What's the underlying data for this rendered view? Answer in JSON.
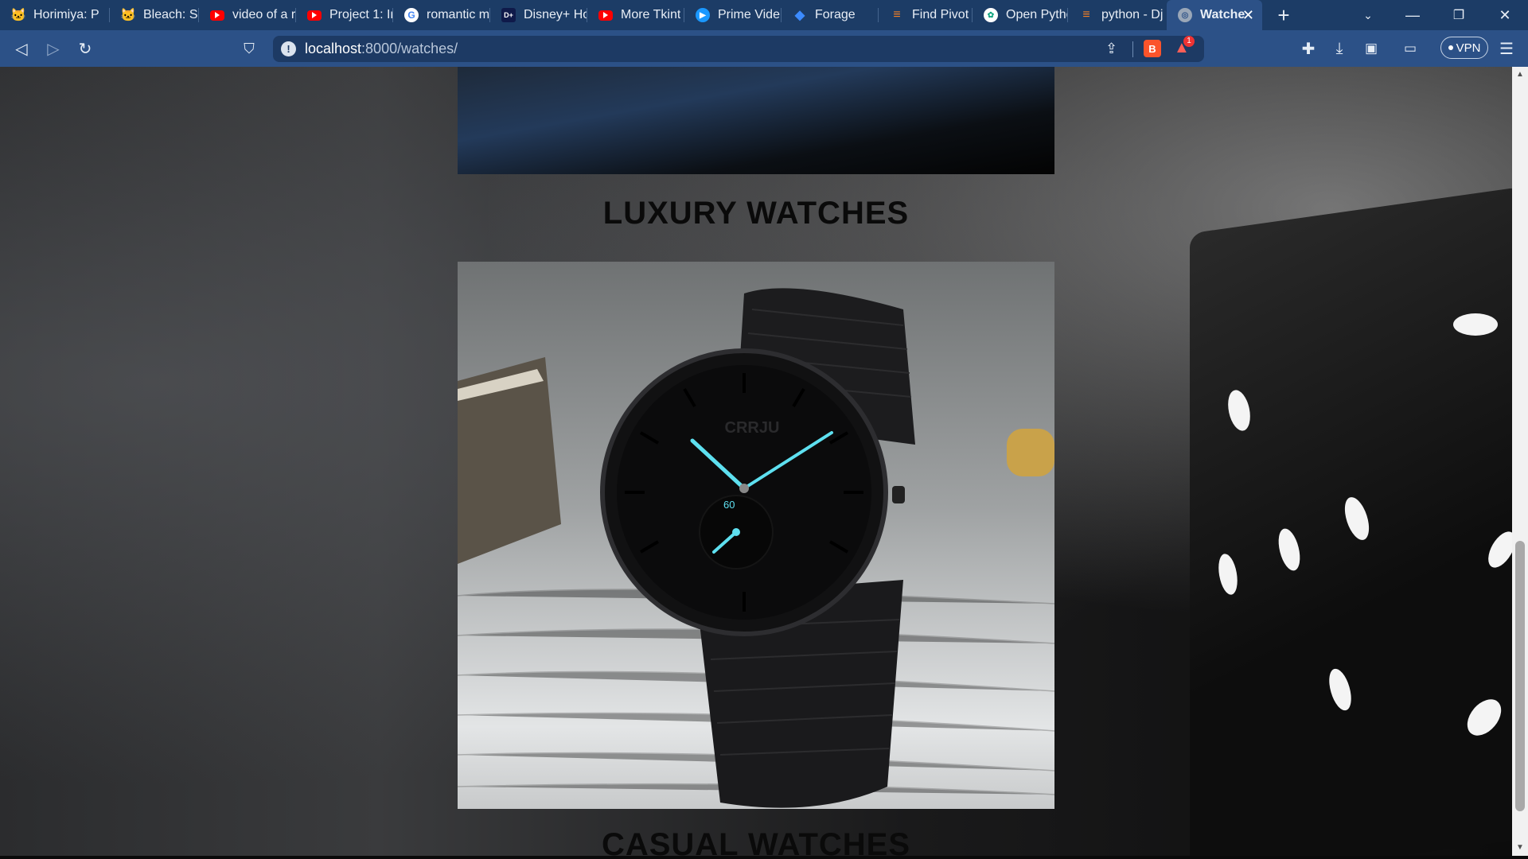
{
  "browser": {
    "tabs": [
      {
        "label": "Horimiya: P",
        "icon": "cat-icon"
      },
      {
        "label": "Bleach: Sen",
        "icon": "cat-icon"
      },
      {
        "label": "video of a r",
        "icon": "youtube-icon"
      },
      {
        "label": "Project 1: Ir",
        "icon": "youtube-icon"
      },
      {
        "label": "romantic m",
        "icon": "google-icon"
      },
      {
        "label": "Disney+ Ho",
        "icon": "disney-icon"
      },
      {
        "label": "More Tkint",
        "icon": "youtube-icon"
      },
      {
        "label": "Prime Vide",
        "icon": "prime-video-icon"
      },
      {
        "label": "Forage",
        "icon": "forage-icon"
      },
      {
        "label": "Find Pivot I",
        "icon": "stackoverflow-icon"
      },
      {
        "label": "Open Pytho",
        "icon": "openai-icon"
      },
      {
        "label": "python - Dj",
        "icon": "stackoverflow-icon"
      },
      {
        "label": "Watche",
        "icon": "globe-icon",
        "active": true
      }
    ],
    "url_host": "localhost",
    "url_path": ":8000/watches/",
    "vpn_label": "VPN",
    "brave_badge": "1"
  },
  "page": {
    "heading_luxury": "LUXURY WATCHES",
    "heading_casual": "CASUAL WATCHES",
    "watch_brand": "CRRJU",
    "watch_subdial": "60"
  },
  "colors": {
    "tabbar": "#1c3c66",
    "toolbar": "#2c5187",
    "watch_hands": "#5ee0f0"
  }
}
